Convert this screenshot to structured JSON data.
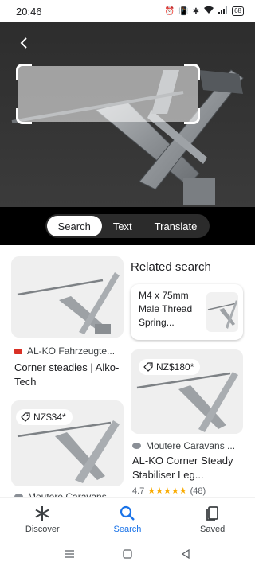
{
  "status_bar": {
    "time": "20:46",
    "icons": [
      "alarm-icon",
      "vibrate-icon",
      "bluetooth-icon",
      "wifi-icon",
      "signal-icon"
    ],
    "battery": "68"
  },
  "lens": {
    "modes": [
      "Search",
      "Text",
      "Translate"
    ],
    "active_mode": "Search"
  },
  "results": {
    "related_heading": "Related search",
    "related_query": "M4 x 75mm Male Thread Spring...",
    "cards": [
      {
        "source": "AL-KO Fahrzeugte...",
        "title": "Corner steadies | Alko-Tech",
        "price": ""
      },
      {
        "source": "",
        "title": "",
        "price": "NZ$34*"
      },
      {
        "source": "Moutere Caravans ...",
        "title": "AL-KO Corner Steady Stabiliser Leg...",
        "price": "NZ$180*",
        "rating": "4.7",
        "stars": "★★★★★",
        "reviews": "(48)"
      },
      {
        "source": "Moutere Caravans",
        "title": "",
        "price": ""
      }
    ]
  },
  "bottom_nav": {
    "items": [
      "Discover",
      "Search",
      "Saved"
    ],
    "active": "Search"
  },
  "colors": {
    "accent": "#1a73e8",
    "star": "#f9ab00",
    "lens_bg": "#1c1c1c"
  }
}
